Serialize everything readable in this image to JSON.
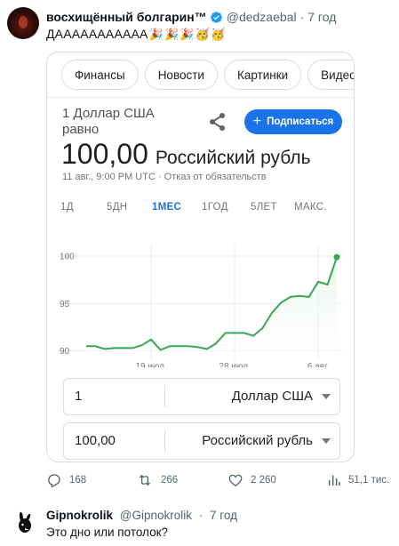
{
  "tweet": {
    "author_name": "восхищённый болгарин™",
    "handle": "@dedzaebal",
    "dot": "·",
    "time": "7 год",
    "text": "ДААААААААААА",
    "emojis": [
      "🎉",
      "🎉",
      "🎉",
      "🥳",
      "🥳"
    ]
  },
  "search_card": {
    "chips": [
      "Финансы",
      "Новости",
      "Картинки",
      "Видео"
    ],
    "equivalence_label": "1 Доллар США равно",
    "result_value": "100,00",
    "result_currency": "Российский рубль",
    "timestamp": "11 авг., 9:00 PM UTC · Отказ от обязательств",
    "subscribe_label": "Подписаться",
    "ranges": [
      {
        "label": "1Д",
        "active": false
      },
      {
        "label": "5ДН",
        "active": false
      },
      {
        "label": "1МЕС",
        "active": true
      },
      {
        "label": "1ГОД",
        "active": false
      },
      {
        "label": "5ЛЕТ",
        "active": false
      },
      {
        "label": "МАКС.",
        "active": false
      }
    ],
    "converter": {
      "from_amount": "1",
      "from_currency": "Доллар США",
      "to_amount": "100,00",
      "to_currency": "Российский рубль"
    }
  },
  "chart_data": {
    "type": "line",
    "title": "",
    "xlabel": "",
    "ylabel": "",
    "y_ticks": [
      90,
      95,
      100
    ],
    "x_tick_labels": [
      "19 июл.",
      "28 июл.",
      "6 авг."
    ],
    "x_tick_indices": [
      7,
      16,
      25
    ],
    "ylim": [
      89.4,
      101.6
    ],
    "values": [
      90.5,
      90.5,
      90.2,
      90.3,
      90.3,
      90.3,
      90.6,
      91.2,
      90.1,
      90.5,
      90.5,
      90.5,
      90.4,
      90.2,
      90.8,
      91.9,
      91.9,
      91.9,
      91.6,
      92.4,
      94.0,
      95.1,
      95.7,
      95.8,
      95.7,
      97.3,
      97.0,
      99.9
    ],
    "line_color": "#34a853",
    "fill_color": "#e6f4ea",
    "grid": true,
    "colors": {
      "accent": "#1a73e8"
    }
  },
  "actions": {
    "replies": "168",
    "retweets": "266",
    "likes": "2 260",
    "views": "51,1 тис."
  },
  "reply": {
    "author_name": "Gipnokrolik",
    "handle": "@Gipnokrolik",
    "dot": "·",
    "time": "7 год",
    "text": "Это дно или потолок?"
  }
}
